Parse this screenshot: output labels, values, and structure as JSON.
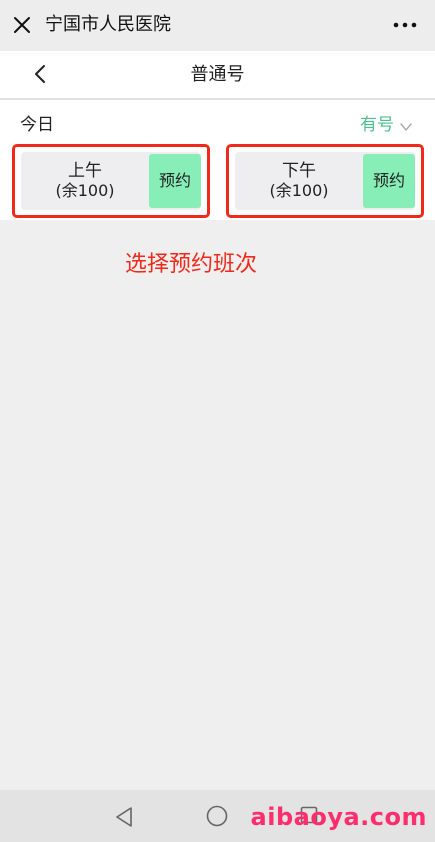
{
  "wechat_bar": {
    "title": "宁国市人民医院",
    "close_icon": "close-icon",
    "more_icon": "more-dots-icon"
  },
  "nav": {
    "title": "普通号",
    "back_icon": "chevron-left-icon"
  },
  "schedule": {
    "date_label": "今日",
    "availability_label": "有号",
    "availability_icon": "chevron-down-icon",
    "slots": [
      {
        "period": "上午",
        "remaining": "(余100)",
        "book_label": "预约"
      },
      {
        "period": "下午",
        "remaining": "(余100)",
        "book_label": "预约"
      }
    ]
  },
  "annotation": {
    "text": "选择预约班次"
  },
  "system_nav": {
    "back_icon": "triangle-back-icon",
    "home_icon": "circle-home-icon",
    "recent_icon": "square-recent-icon"
  },
  "watermark": {
    "text": "aibaoya.com"
  },
  "colors": {
    "accent_green": "#4fc08d",
    "book_button": "#86eeb6",
    "highlight_red": "#f02a1a",
    "watermark": "#ff2d6e"
  }
}
